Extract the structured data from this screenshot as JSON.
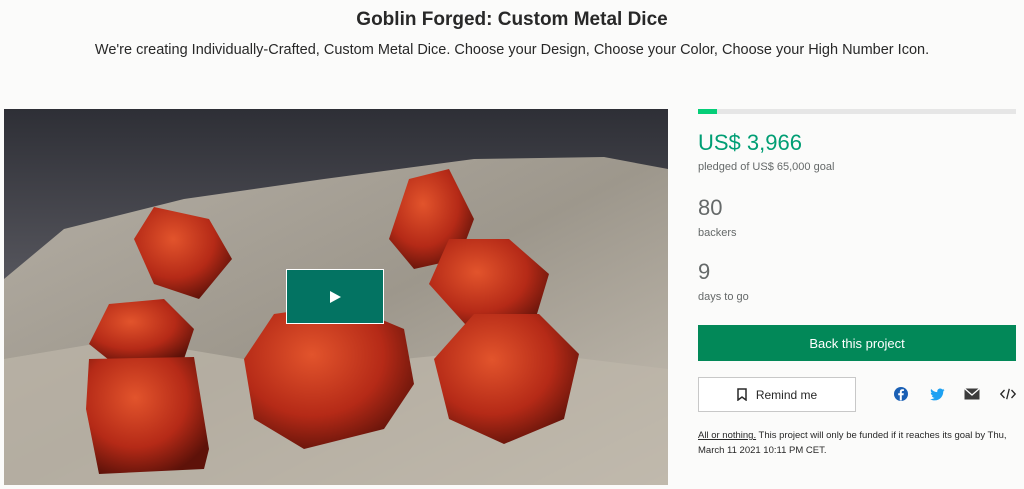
{
  "project": {
    "title": "Goblin Forged: Custom Metal Dice",
    "subtitle": "We're creating Individually-Crafted, Custom Metal Dice. Choose your Design, Choose your Color, Choose your High Number Icon."
  },
  "media": {
    "play_icon": "play-icon"
  },
  "funding": {
    "progress_fraction": 0.061,
    "pledged_amount": "US$ 3,966",
    "pledged_goal": "pledged of US$ 65,000 goal",
    "backers_count": "80",
    "backers_label": "backers",
    "days_count": "9",
    "days_label": "days to go"
  },
  "actions": {
    "back_label": "Back this project",
    "remind_label": "Remind me",
    "remind_icon": "bookmark-icon",
    "share_icons": [
      "facebook-icon",
      "twitter-icon",
      "email-icon",
      "embed-icon"
    ]
  },
  "fine_print": {
    "link": "All or nothing.",
    "text": " This project will only be funded if it reaches its goal by Thu, March 11 2021 10:11 PM CET."
  },
  "colors": {
    "accent_green": "#009e74",
    "button_green": "#028858",
    "play_teal": "#037362",
    "progress_green": "#05ce78",
    "facebook_blue": "#1877f2",
    "twitter_blue": "#1da1f2"
  }
}
